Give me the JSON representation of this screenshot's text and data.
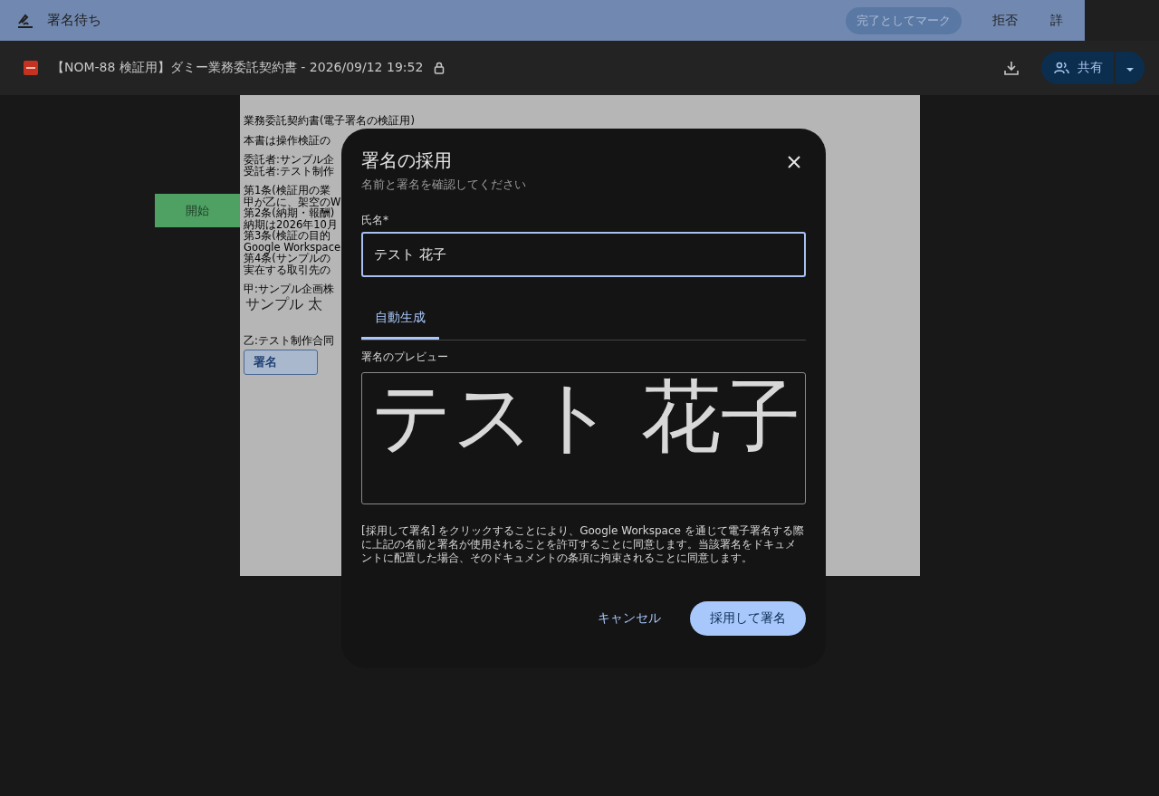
{
  "top_bar": {
    "title": "署名待ち",
    "actions": [
      {
        "label": "完了としてマーク",
        "kind": "pill"
      },
      {
        "label": "拒否",
        "kind": "text"
      },
      {
        "label": "詳",
        "kind": "text"
      }
    ]
  },
  "doc_bar": {
    "file_title": "【NOM-88 検証用】ダミー業務委託契約書 - 2026/09/12 19:52",
    "locked": true,
    "share_label": "共有"
  },
  "start_button": "開始",
  "document": {
    "paragraphs": [
      [
        "業務委託契約書(電子署名の検証用)"
      ],
      [
        "本書は操作検証の"
      ],
      [
        "委託者:サンプル企",
        "受託者:テスト制作"
      ],
      [
        "第1条(検証用の業",
        "甲が乙に、架空のW",
        "第2条(納期・報酬)",
        "納期は2026年10月",
        "第3条(検証の目的",
        "Google Workspace",
        "第4条(サンプルの",
        "実在する取引先の"
      ]
    ],
    "party_a_label": "甲:サンプル企画株",
    "party_a_signature": "サンプル 太",
    "party_b_label": "乙:テスト制作合同",
    "sign_field": "署名"
  },
  "dialog": {
    "title": "署名の採用",
    "subtitle": "名前と署名を確認してください",
    "name_label": "氏名*",
    "name_value": "テスト 花子",
    "tabs": [
      {
        "label": "自動生成",
        "selected": true
      }
    ],
    "preview_label": "署名のプレビュー",
    "preview_text": "テスト 花子",
    "consent": "[採用して署名] をクリックすることにより、Google Workspace を通じて電子署名する際に上記の名前と署名が使用されることを許可することに同意します。当該署名をドキュメントに配置した場合、そのドキュメントの条項に拘束されることに同意します。",
    "cancel_button": "キャンセル",
    "adopt_button": "採用して署名"
  }
}
